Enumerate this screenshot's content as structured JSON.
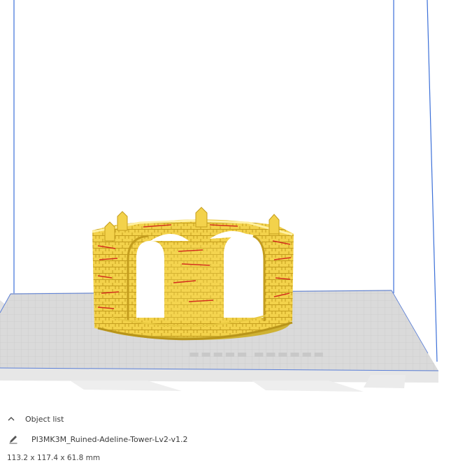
{
  "object_list": {
    "header_label": "Object list",
    "header_icon": "chevron-up-icon",
    "object_name": "PI3MK3M_Ruined-Adeline-Tower-Lv2-v1.2",
    "edit_icon": "pencil-icon",
    "dimensions": "113.2 x 117.4 x 61.8 mm"
  },
  "colors": {
    "model": "#f4d44a",
    "model_shadow": "#c9a521",
    "overhang": "#d4301e",
    "bed": "#d9d9d9",
    "build_volume_edge": "#3b6fd8"
  }
}
